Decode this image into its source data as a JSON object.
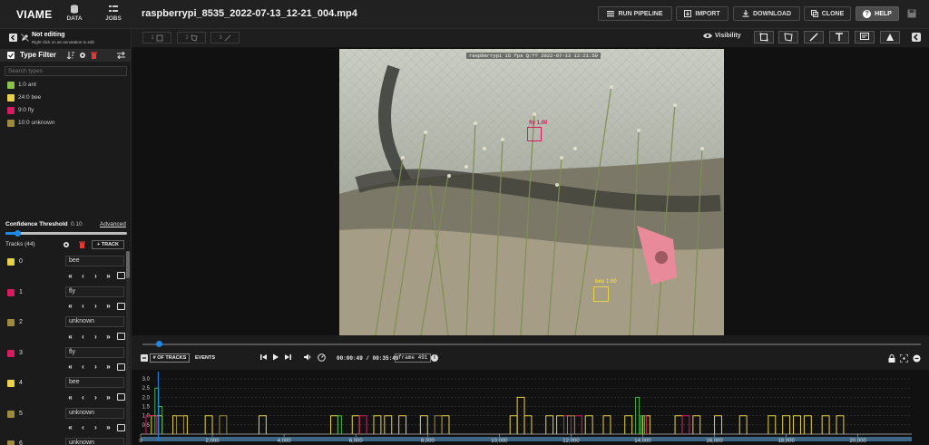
{
  "app": {
    "brand": "VIAME",
    "nav": [
      {
        "label": "DATA",
        "icon": "database-icon"
      },
      {
        "label": "JOBS",
        "icon": "jobs-icon"
      }
    ],
    "file_title": "raspberrypi_8535_2022-07-13_12-21_004.mp4"
  },
  "toolbar": {
    "run_pipeline": "RUN PIPELINE",
    "import": "IMPORT",
    "download": "DOWNLOAD",
    "clone": "CLONE",
    "help": "HELP"
  },
  "editbar": {
    "buttons": [
      {
        "num": "1"
      },
      {
        "num": "2"
      },
      {
        "num": "3"
      }
    ],
    "visibility_label": "Visibility"
  },
  "editing": {
    "title": "Not editing",
    "subtitle": "Right click on an annotation to edit"
  },
  "type_filter": {
    "title": "Type Filter",
    "search_placeholder": "Search types",
    "types": [
      {
        "label": "1:0 ant",
        "color": "#8bc34a"
      },
      {
        "label": "24:0 bee",
        "color": "#e6d34a"
      },
      {
        "label": "9:0 fly",
        "color": "#d81b60"
      },
      {
        "label": "10:0 unknown",
        "color": "#9e8a3c"
      }
    ]
  },
  "confidence": {
    "label": "Confidence Threshold",
    "value": "0.10",
    "fraction": 0.1,
    "advanced": "Advanced"
  },
  "tracks": {
    "label": "Tracks (44)",
    "add_label": "+ TRACK",
    "items": [
      {
        "id": "0",
        "type": "bee",
        "color": "#e6d34a"
      },
      {
        "id": "1",
        "type": "fly",
        "color": "#d81b60"
      },
      {
        "id": "2",
        "type": "unknown",
        "color": "#9e8a3c"
      },
      {
        "id": "3",
        "type": "fly",
        "color": "#d81b60"
      },
      {
        "id": "4",
        "type": "bee",
        "color": "#e6d34a"
      },
      {
        "id": "5",
        "type": "unknown",
        "color": "#9e8a3c"
      },
      {
        "id": "6",
        "type": "unknown",
        "color": "#9e8a3c"
      }
    ]
  },
  "video": {
    "overlay": "raspberrypi 15 fps Q:?? 2022-07-13 12:21:50",
    "annotations": [
      {
        "label": "fly 1.00",
        "color": "#d81b60"
      },
      {
        "label": "bee 1.00",
        "color": "#e6d34a"
      }
    ]
  },
  "controls": {
    "tab_tracks": "# OF TRACKS",
    "tab_events": "EVENTS",
    "time": "00:00:49 / 00:35:49",
    "frame": "frame 491",
    "progress": 0.022
  },
  "chart_data": {
    "type": "bar",
    "yticks": [
      "3.0",
      "2.5",
      "2.0",
      "1.5",
      "1.0",
      "0.5"
    ],
    "xticks": [
      "0",
      "2,000",
      "4,000",
      "6,000",
      "8,000",
      "10,000",
      "12,000",
      "14,000",
      "16,000",
      "18,000",
      "20,000"
    ],
    "xlim": [
      0,
      21500
    ],
    "ylim": [
      0,
      3.3
    ],
    "series": [
      {
        "color": "#e6d34a",
        "bars": [
          [
            300,
            600,
            1
          ],
          [
            900,
            1300,
            1
          ],
          [
            1800,
            2000,
            1
          ],
          [
            3300,
            3500,
            1
          ],
          [
            5300,
            5500,
            1
          ],
          [
            5900,
            6100,
            1
          ],
          [
            6500,
            6700,
            1
          ],
          [
            6800,
            7000,
            1
          ],
          [
            7200,
            7400,
            1
          ],
          [
            7800,
            8000,
            1
          ],
          [
            8400,
            8600,
            1
          ],
          [
            10300,
            10500,
            1
          ],
          [
            10500,
            10700,
            2
          ],
          [
            10700,
            10900,
            1
          ],
          [
            11300,
            11500,
            1
          ],
          [
            11600,
            11800,
            1
          ],
          [
            12400,
            12600,
            1
          ],
          [
            12900,
            13100,
            1
          ],
          [
            13500,
            13700,
            1
          ],
          [
            14000,
            14200,
            1
          ],
          [
            14900,
            15100,
            1
          ],
          [
            15400,
            15600,
            1
          ],
          [
            16000,
            16200,
            1
          ],
          [
            16700,
            16900,
            1
          ],
          [
            17500,
            17700,
            1
          ],
          [
            17900,
            18100,
            1
          ],
          [
            18200,
            18400,
            1
          ],
          [
            18500,
            18700,
            1
          ],
          [
            19000,
            19200,
            1
          ],
          [
            19400,
            19600,
            1
          ]
        ]
      },
      {
        "color": "#d81b60",
        "bars": [
          [
            150,
            450,
            1
          ],
          [
            6100,
            6300,
            1
          ],
          [
            11800,
            12000,
            1
          ],
          [
            12100,
            12300,
            1
          ],
          [
            13900,
            14100,
            1
          ],
          [
            15100,
            15300,
            1
          ]
        ]
      },
      {
        "color": "#9e8a3c",
        "bars": [
          [
            1000,
            1200,
            1
          ],
          [
            2200,
            2400,
            1
          ],
          [
            8200,
            8400,
            1
          ],
          [
            11900,
            12100,
            1
          ]
        ]
      },
      {
        "color": "#4caf50",
        "bars": [
          [
            400,
            500,
            2.5
          ],
          [
            500,
            600,
            1.5
          ],
          [
            5500,
            5600,
            1
          ],
          [
            13800,
            13900,
            2
          ],
          [
            13950,
            14050,
            1
          ]
        ]
      }
    ]
  }
}
